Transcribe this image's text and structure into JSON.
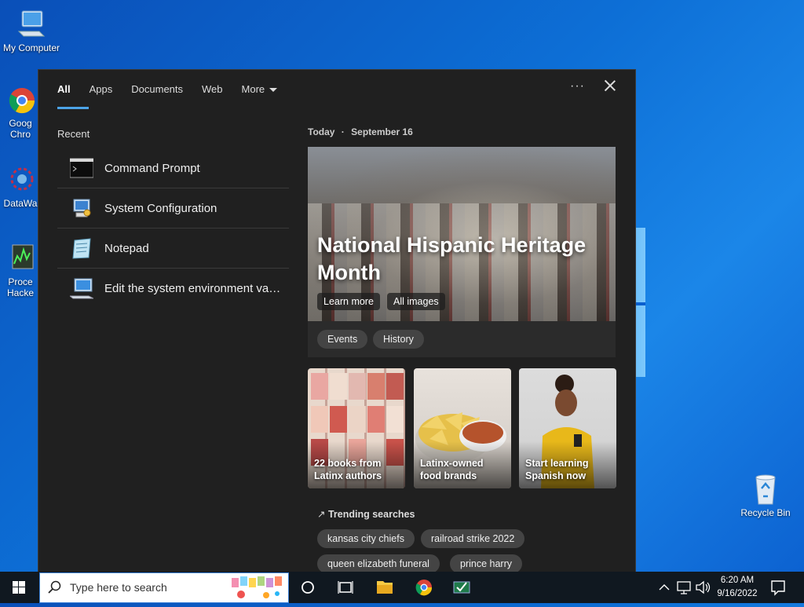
{
  "desktop": {
    "icons": [
      {
        "label": "My Computer"
      },
      {
        "label": "Goog\nChro"
      },
      {
        "label": "DataWa"
      },
      {
        "label": "Proce\nHacke"
      },
      {
        "label": "Recycle Bin"
      }
    ]
  },
  "search_panel": {
    "tabs": [
      {
        "label": "All"
      },
      {
        "label": "Apps"
      },
      {
        "label": "Documents"
      },
      {
        "label": "Web"
      },
      {
        "label": "More"
      }
    ],
    "recent": {
      "title": "Recent",
      "items": [
        {
          "label": "Command Prompt",
          "icon": "command-prompt-icon"
        },
        {
          "label": "System Configuration",
          "icon": "system-configuration-icon"
        },
        {
          "label": "Notepad",
          "icon": "notepad-icon"
        },
        {
          "label": "Edit the system environment vari...",
          "icon": "system-properties-icon"
        }
      ]
    },
    "today": {
      "label": "Today",
      "separator": "·",
      "date": "September 16"
    },
    "hero": {
      "title": "National Hispanic Heritage Month",
      "learn_more": "Learn more",
      "all_images": "All images"
    },
    "chips": [
      "Events",
      "History"
    ],
    "cards": [
      {
        "caption": "22 books from Latinx authors"
      },
      {
        "caption": "Latinx-owned food brands"
      },
      {
        "caption": "Start learning Spanish now"
      }
    ],
    "trending": {
      "title": "Trending searches",
      "items": [
        "kansas city chiefs",
        "railroad strike 2022",
        "queen elizabeth funeral",
        "prince harry"
      ]
    }
  },
  "taskbar": {
    "search_placeholder": "Type here to search",
    "time": "6:20 AM",
    "date": "9/16/2022"
  },
  "colors": {
    "accent": "#4ca3e6",
    "panel_bg": "#202020",
    "taskbar_bg": "#101820"
  }
}
